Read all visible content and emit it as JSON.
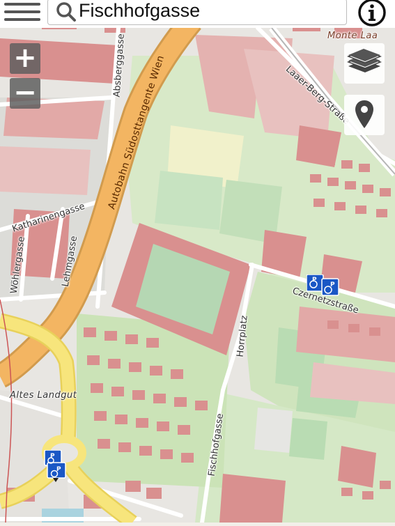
{
  "search": {
    "value": "Fischhofgasse"
  },
  "labels": {
    "absberggasse": "Absberggasse",
    "suedosttangente": "Autobahn Südosttangente Wien",
    "laaer_berg": "Laaer-Berg-Straße",
    "monte_laa": "Monte Laa",
    "katharinengasse": "Katharinengasse",
    "woehlergasse": "Wöhlergasse",
    "lehmgasse": "Lehmgasse",
    "czernetzstrasse": "Czernetzstraße",
    "horrplatz": "Horrplatz",
    "fischhofgasse": "Fischhofgasse",
    "altes_landgut": "Altes Landgut"
  },
  "controls": {
    "zoom_in": "+",
    "zoom_out": "−"
  },
  "icons": {
    "menu": "menu-icon",
    "search": "search-icon",
    "info": "info-icon",
    "layers": "layers-icon",
    "location": "location-pin-icon",
    "parking": "accessible-parking-icon"
  },
  "colors": {
    "land": "#f2efe9",
    "grass": "#cdebb0",
    "residential": "#e0dfdf",
    "building": "#d9908f",
    "pitch": "#aae0cb",
    "motorway": "#f3b562",
    "primary_road": "#f7e57c",
    "parking_blue": "#1a57c5"
  }
}
